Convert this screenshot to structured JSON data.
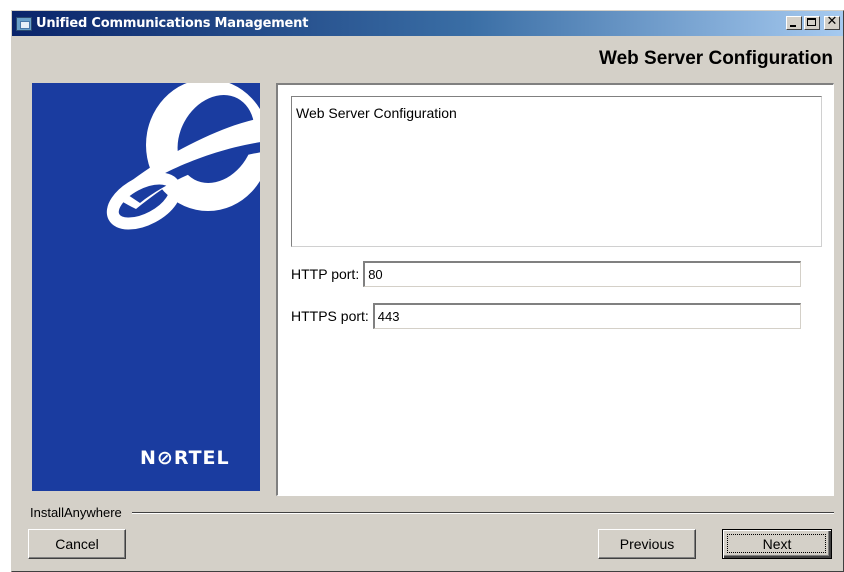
{
  "window": {
    "title": "Unified Communications Management",
    "title_icon": "app-window-icon",
    "controls": [
      "minimize-icon",
      "maximize-icon",
      "close-icon"
    ],
    "close_glyph": "✕"
  },
  "header": {
    "heading": "Web Server Configuration"
  },
  "brand": {
    "logo_text": "N⊘RTEL",
    "panel_color": "#1a3ca0"
  },
  "content": {
    "description": "Web Server Configuration",
    "fields": [
      {
        "label": "HTTP port:",
        "value": "80"
      },
      {
        "label": "HTTPS port:",
        "value": "443"
      }
    ]
  },
  "footer": {
    "group_label": "InstallAnywhere",
    "buttons": {
      "cancel": "Cancel",
      "previous": "Previous",
      "next": "Next"
    }
  },
  "colors": {
    "titlebar_start": "#0a246a",
    "titlebar_end": "#a6caf0",
    "dialog_face": "#d4d0c8"
  }
}
